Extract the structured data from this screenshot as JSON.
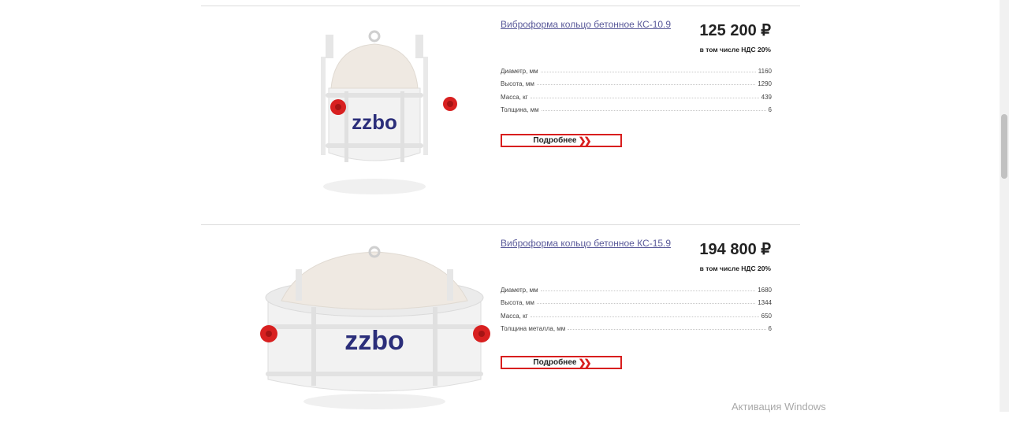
{
  "products": [
    {
      "title": "Виброформа кольцо бетонное КС-10.9",
      "price": "125 200 ₽",
      "vat_note": "в том числе НДС 20%",
      "brand_logo": "zzbo",
      "specs": [
        {
          "label": "Диаметр, мм",
          "value": "1160"
        },
        {
          "label": "Высота, мм",
          "value": "1290"
        },
        {
          "label": "Масса, кг",
          "value": "439"
        },
        {
          "label": "Толщина, мм",
          "value": "6"
        }
      ],
      "more_label": "Подробнее"
    },
    {
      "title": "Виброформа кольцо бетонное КС-15.9",
      "price": "194 800 ₽",
      "vat_note": "в том числе НДС 20%",
      "brand_logo": "zzbo",
      "specs": [
        {
          "label": "Диаметр, мм",
          "value": "1680"
        },
        {
          "label": "Высота, мм",
          "value": "1344"
        },
        {
          "label": "Масса, кг",
          "value": "650"
        },
        {
          "label": "Толщина металла, мм",
          "value": "6"
        }
      ],
      "more_label": "Подробнее"
    }
  ],
  "system": {
    "watermark": "Активация Windows"
  },
  "colors": {
    "accent": "#d81e1e",
    "link": "#5a5a9a",
    "logo": "#2b2e7a"
  }
}
